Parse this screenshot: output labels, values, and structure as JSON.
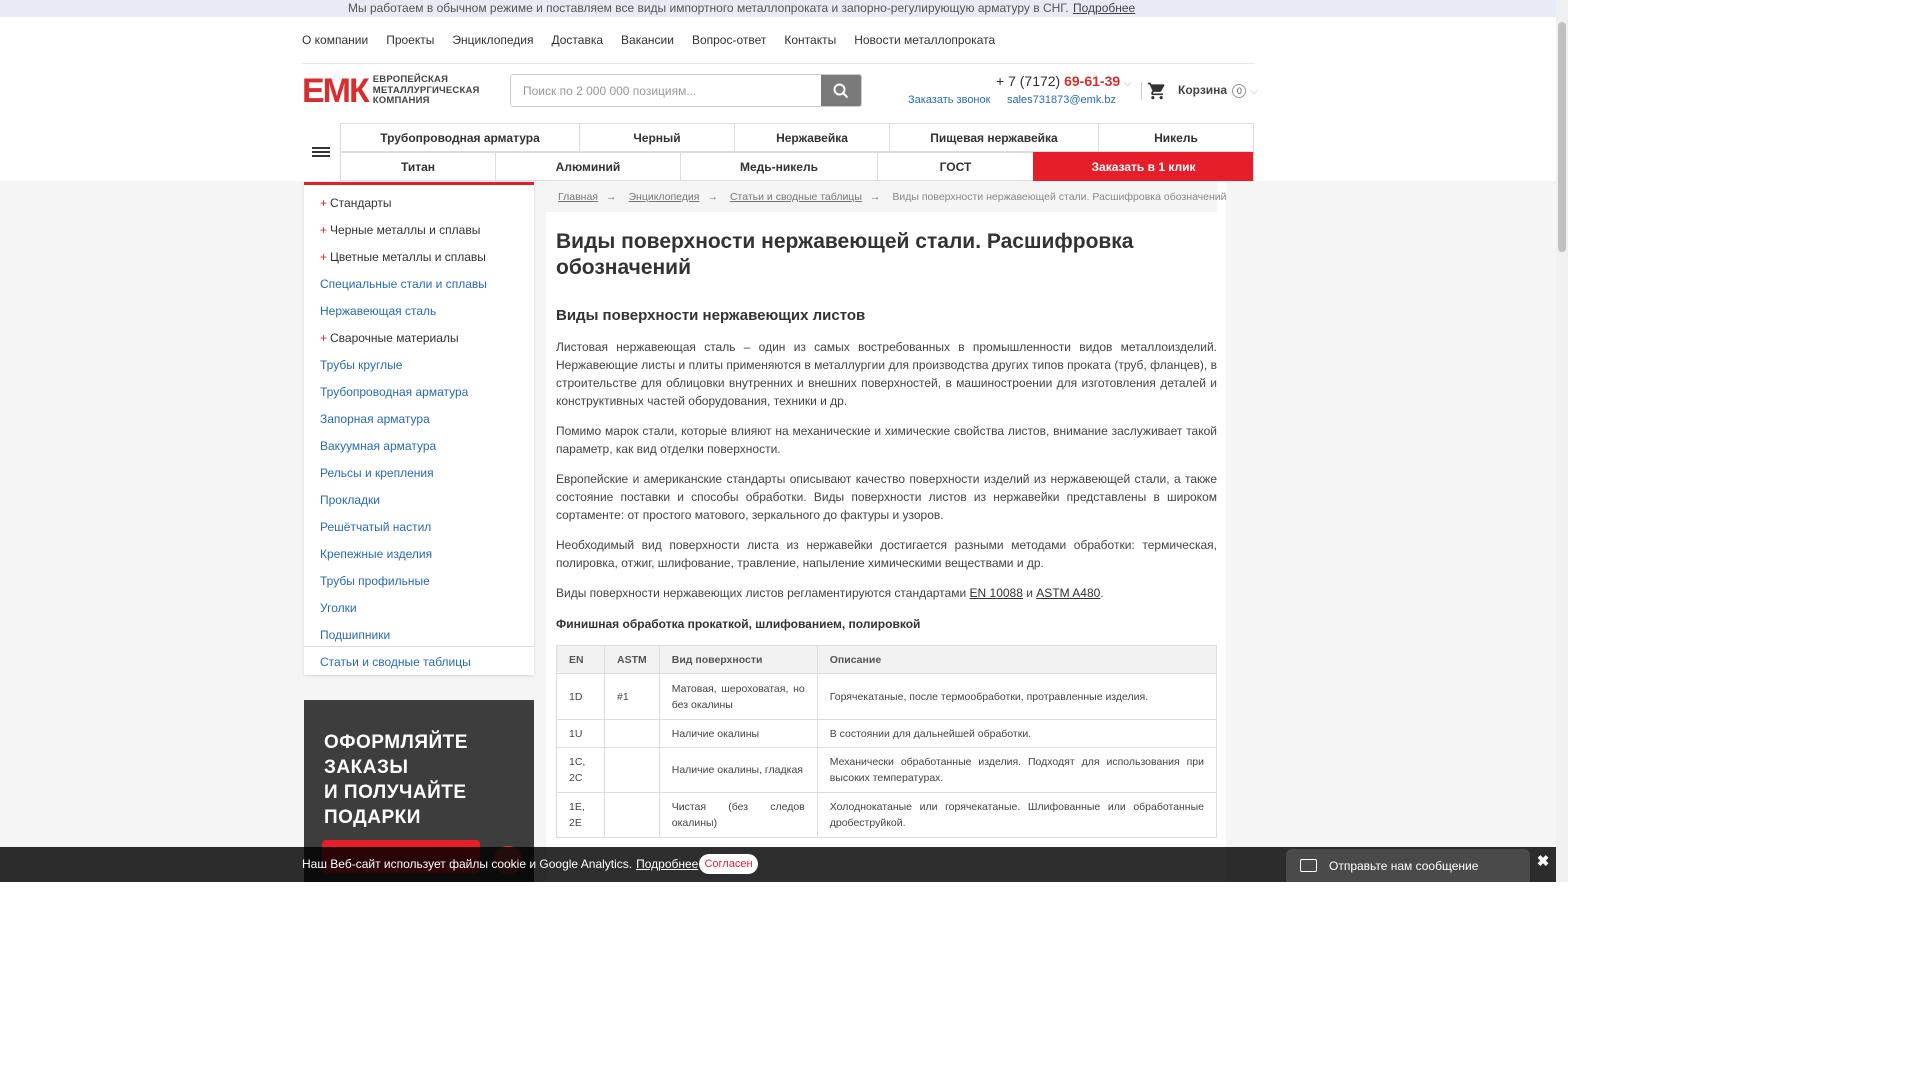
{
  "topbar": {
    "message": "Мы работаем в обычном режиме и поставляем все виды импортного металлопроката и запорно-регулирующую арматуру в СНГ.",
    "more": "Подробнее"
  },
  "nav": [
    "О компании",
    "Проекты",
    "Энциклопедия",
    "Доставка",
    "Вакансии",
    "Вопрос-ответ",
    "Контакты",
    "Новости металлопроката"
  ],
  "logo": {
    "mark": "ЕМК",
    "line1": "ЕВРОПЕЙСКАЯ",
    "line2": "МЕТАЛЛУРГИЧЕСКАЯ",
    "line3": "КОМПАНИЯ"
  },
  "search": {
    "placeholder": "Поиск по 2 000 000 позициям..."
  },
  "contacts": {
    "phone_prefix": "+ 7 (7172) ",
    "phone_main": "69-61-39",
    "callback": "Заказать звонок",
    "email": "sales731873@emk.bz"
  },
  "cart": {
    "label": "Корзина",
    "count": "0"
  },
  "categories": {
    "row1": [
      "Трубопроводная арматура",
      "Черный",
      "Нержавейка",
      "Пищевая нержавейка",
      "Никель"
    ],
    "row2": [
      "Титан",
      "Алюминий",
      "Медь-никель",
      "ГОСТ",
      "Заказать в 1 клик"
    ]
  },
  "sidebar": [
    {
      "label": "Стандарты",
      "plus": true
    },
    {
      "label": "Черные металлы и сплавы",
      "plus": true
    },
    {
      "label": "Цветные металлы и сплавы",
      "plus": true
    },
    {
      "label": "Специальные стали и сплавы",
      "plus": false
    },
    {
      "label": "Нержавеющая сталь",
      "plus": false
    },
    {
      "label": "Сварочные материалы",
      "plus": true
    },
    {
      "label": "Трубы круглые",
      "plus": false
    },
    {
      "label": "Трубопроводная арматура",
      "plus": false
    },
    {
      "label": "Запорная арматура",
      "plus": false
    },
    {
      "label": "Вакуумная арматура",
      "plus": false
    },
    {
      "label": "Рельсы и крепления",
      "plus": false
    },
    {
      "label": "Прокладки",
      "plus": false
    },
    {
      "label": "Решётчатый настил",
      "plus": false
    },
    {
      "label": "Крепежные изделия",
      "plus": false
    },
    {
      "label": "Трубы профильные",
      "plus": false
    },
    {
      "label": "Уголки",
      "plus": false
    },
    {
      "label": "Подшипники",
      "plus": false
    },
    {
      "label": "Статьи и сводные таблицы",
      "plus": false
    }
  ],
  "promo": {
    "line1": "ОФОРМЛЯЙТЕ",
    "line2": "ЗАКАЗЫ",
    "line3": "И ПОЛУЧАЙТЕ",
    "line4": "ПОДАРКИ"
  },
  "breadcrumbs": [
    "Главная",
    "Энциклопедия",
    "Статьи и сводные таблицы",
    "Виды поверхности нержавеющей стали. Расшифровка обозначений"
  ],
  "article": {
    "title": "Виды поверхности нержавеющей стали. Расшифровка обозначений",
    "subtitle": "Виды поверхности нержавеющих листов",
    "p1": "Листовая нержавеющая сталь – один из самых востребованных в промышленности видов металлоизделий. Нержавеющие листы и плиты применяются в металлургии для производства других типов проката (труб, фланцев), в строительстве для облицовки внутренних и внешних поверхностей, в машиностроении для изготовления деталей и конструктивных частей оборудования, техники и др.",
    "p2": "Помимо марок стали, которые влияют на механические и химические свойства листов, внимание заслуживает такой параметр, как вид отделки поверхности.",
    "p3": "Европейские и американские стандарты описывают качество поверхности изделий из нержавеющей стали, а также состояние поставки и способы обработки. Виды поверхности листов из нержавейки представлены в широком сортаменте: от простого матового, зеркального до фактуры и узоров.",
    "p4": "Необходимый вид поверхности листа из нержавейки достигается разными методами обработки: термическая, полировка, отжиг, шлифование, травление, напыление химическими веществами и др.",
    "p5_pre": "Виды поверхности нержавеющих листов регламентируются стандартами ",
    "p5_link1": "EN 10088",
    "p5_mid": " и ",
    "p5_link2": "ASTM A480",
    "p5_post": ".",
    "table_title": "Финишная обработка прокаткой, шлифованием, полировкой"
  },
  "table": {
    "headers": [
      "EN",
      "ASTM",
      "Вид поверхности",
      "Описание"
    ],
    "rows": [
      [
        "1D",
        "#1",
        "Матовая, шероховатая, но без окалины",
        "Горячекатаные, после термообработки, протравленные изделия."
      ],
      [
        "1U",
        "",
        "Наличие окалины",
        "В состоянии для дальнейшей обработки."
      ],
      [
        "1C, 2C",
        "",
        "Наличие окалины, гладкая",
        "Механически обработанные изделия. Подходят для использования при высоких температурах."
      ],
      [
        "1E, 2E",
        "",
        "Чистая (без следов окалины)",
        "Холоднокатаные или горячекатаные. Шлифованные или обработанные дробеструйкой."
      ]
    ]
  },
  "cookie": {
    "text": "Наш Веб-сайт использует файлы cookie и Google Analytics.",
    "more": "Подробнее",
    "accept": "Согласен"
  },
  "chat": {
    "label": "Отправьте нам сообщение",
    "close": "✖"
  }
}
